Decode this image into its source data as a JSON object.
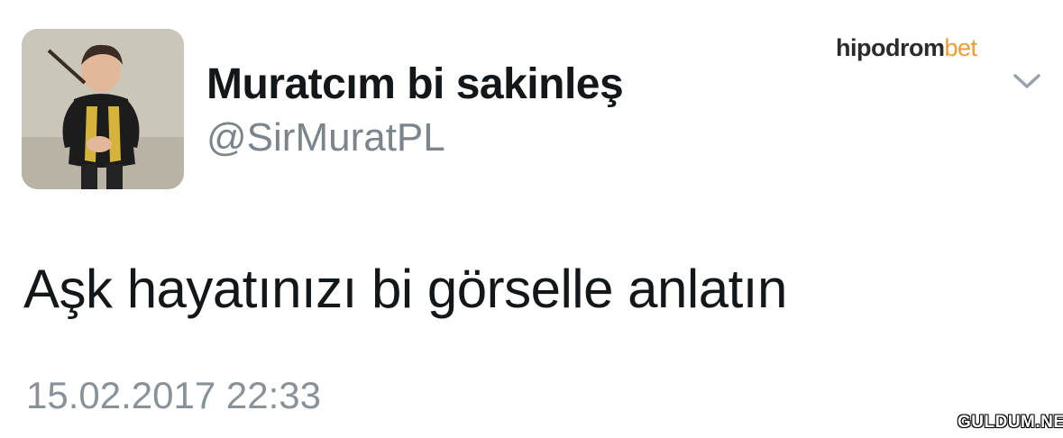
{
  "tweet": {
    "display_name": "Muratcım bi sakinleş",
    "handle": "@SirMuratPL",
    "text": "Aşk hayatınızı bi görselle anlatın",
    "timestamp": "15.02.2017 22:33",
    "menu_icon": "chevron-down-icon"
  },
  "watermarks": {
    "brand_dark": "hipodrom",
    "brand_accent": "bet",
    "site": "GULDUM.NET"
  },
  "colors": {
    "text_primary": "#14171a",
    "text_secondary": "#7d858c",
    "brand_accent": "#f29b32",
    "chevron": "#9aa3ab"
  }
}
